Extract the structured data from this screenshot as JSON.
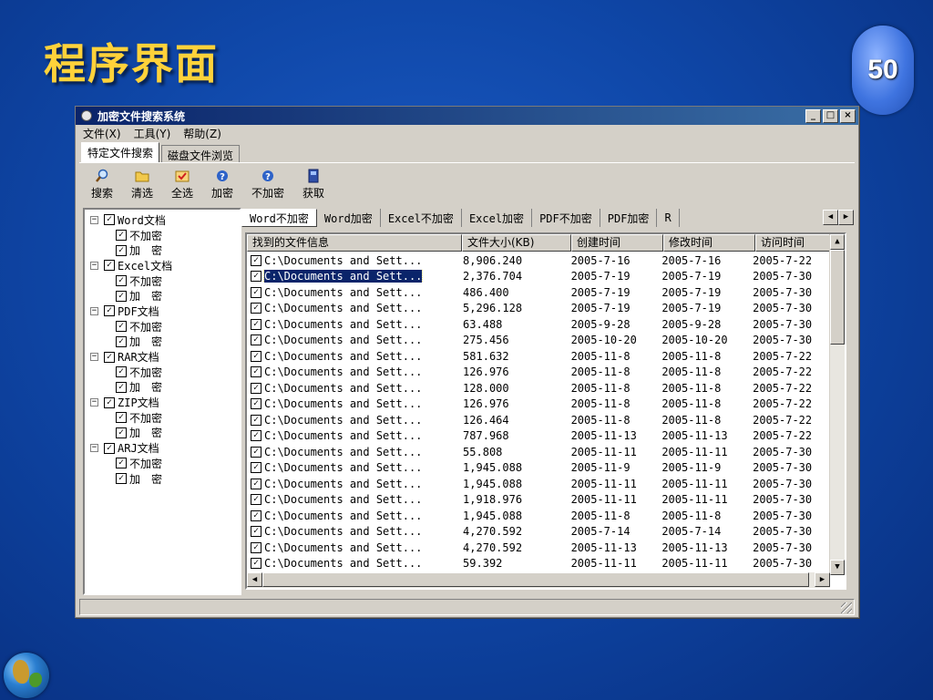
{
  "slide": {
    "title": "程序界面",
    "page_number": "50"
  },
  "window": {
    "title": "加密文件搜索系统",
    "controls": [
      "_",
      "□",
      "×"
    ],
    "menu": [
      "文件(X)",
      "工具(Y)",
      "帮助(Z)"
    ],
    "tabs": [
      {
        "label": "特定文件搜索",
        "active": true
      },
      {
        "label": "磁盘文件浏览",
        "active": false
      }
    ],
    "toolbar": [
      {
        "label": "搜索",
        "icon": "magnifier-icon"
      },
      {
        "label": "清选",
        "icon": "folder-icon"
      },
      {
        "label": "全选",
        "icon": "envelope-check-icon"
      },
      {
        "label": "加密",
        "icon": "help-icon"
      },
      {
        "label": "不加密",
        "icon": "help-icon"
      },
      {
        "label": "获取",
        "icon": "document-icon"
      }
    ]
  },
  "tree": [
    {
      "label": "Word文档",
      "children": [
        "不加密",
        "加　密"
      ]
    },
    {
      "label": "Excel文档",
      "children": [
        "不加密",
        "加　密"
      ]
    },
    {
      "label": "PDF文档",
      "children": [
        "不加密",
        "加　密"
      ]
    },
    {
      "label": "RAR文档",
      "children": [
        "不加密",
        "加　密"
      ]
    },
    {
      "label": "ZIP文档",
      "children": [
        "不加密",
        "加　密"
      ]
    },
    {
      "label": "ARJ文档",
      "children": [
        "不加密",
        "加　密"
      ]
    }
  ],
  "subtabs": [
    "Word不加密",
    "Word加密",
    "Excel不加密",
    "Excel加密",
    "PDF不加密",
    "PDF加密",
    "R"
  ],
  "table": {
    "columns": [
      "找到的文件信息",
      "文件大小(KB)",
      "创建时间",
      "修改时间",
      "访问时间"
    ],
    "rows": [
      [
        "C:\\Documents and Sett...",
        "8,906.240",
        "2005-7-16",
        "2005-7-16",
        "2005-7-22"
      ],
      [
        "C:\\Documents and Sett...",
        "2,376.704",
        "2005-7-19",
        "2005-7-19",
        "2005-7-30"
      ],
      [
        "C:\\Documents and Sett...",
        "486.400",
        "2005-7-19",
        "2005-7-19",
        "2005-7-30"
      ],
      [
        "C:\\Documents and Sett...",
        "5,296.128",
        "2005-7-19",
        "2005-7-19",
        "2005-7-30"
      ],
      [
        "C:\\Documents and Sett...",
        "63.488",
        "2005-9-28",
        "2005-9-28",
        "2005-7-30"
      ],
      [
        "C:\\Documents and Sett...",
        "275.456",
        "2005-10-20",
        "2005-10-20",
        "2005-7-30"
      ],
      [
        "C:\\Documents and Sett...",
        "581.632",
        "2005-11-8",
        "2005-11-8",
        "2005-7-22"
      ],
      [
        "C:\\Documents and Sett...",
        "126.976",
        "2005-11-8",
        "2005-11-8",
        "2005-7-22"
      ],
      [
        "C:\\Documents and Sett...",
        "128.000",
        "2005-11-8",
        "2005-11-8",
        "2005-7-22"
      ],
      [
        "C:\\Documents and Sett...",
        "126.976",
        "2005-11-8",
        "2005-11-8",
        "2005-7-22"
      ],
      [
        "C:\\Documents and Sett...",
        "126.464",
        "2005-11-8",
        "2005-11-8",
        "2005-7-22"
      ],
      [
        "C:\\Documents and Sett...",
        "787.968",
        "2005-11-13",
        "2005-11-13",
        "2005-7-22"
      ],
      [
        "C:\\Documents and Sett...",
        "55.808",
        "2005-11-11",
        "2005-11-11",
        "2005-7-30"
      ],
      [
        "C:\\Documents and Sett...",
        "1,945.088",
        "2005-11-9",
        "2005-11-9",
        "2005-7-30"
      ],
      [
        "C:\\Documents and Sett...",
        "1,945.088",
        "2005-11-11",
        "2005-11-11",
        "2005-7-30"
      ],
      [
        "C:\\Documents and Sett...",
        "1,918.976",
        "2005-11-11",
        "2005-11-11",
        "2005-7-30"
      ],
      [
        "C:\\Documents and Sett...",
        "1,945.088",
        "2005-11-8",
        "2005-11-8",
        "2005-7-30"
      ],
      [
        "C:\\Documents and Sett...",
        "4,270.592",
        "2005-7-14",
        "2005-7-14",
        "2005-7-30"
      ],
      [
        "C:\\Documents and Sett...",
        "4,270.592",
        "2005-11-13",
        "2005-11-13",
        "2005-7-30"
      ],
      [
        "C:\\Documents and Sett...",
        "59.392",
        "2005-11-11",
        "2005-11-11",
        "2005-7-30"
      ]
    ],
    "selected_row": 1
  },
  "colors": {
    "title_text": "#ffd23a",
    "titlebar_start": "#0a246a",
    "titlebar_end": "#3a6ea5",
    "selection": "#0a246a"
  }
}
